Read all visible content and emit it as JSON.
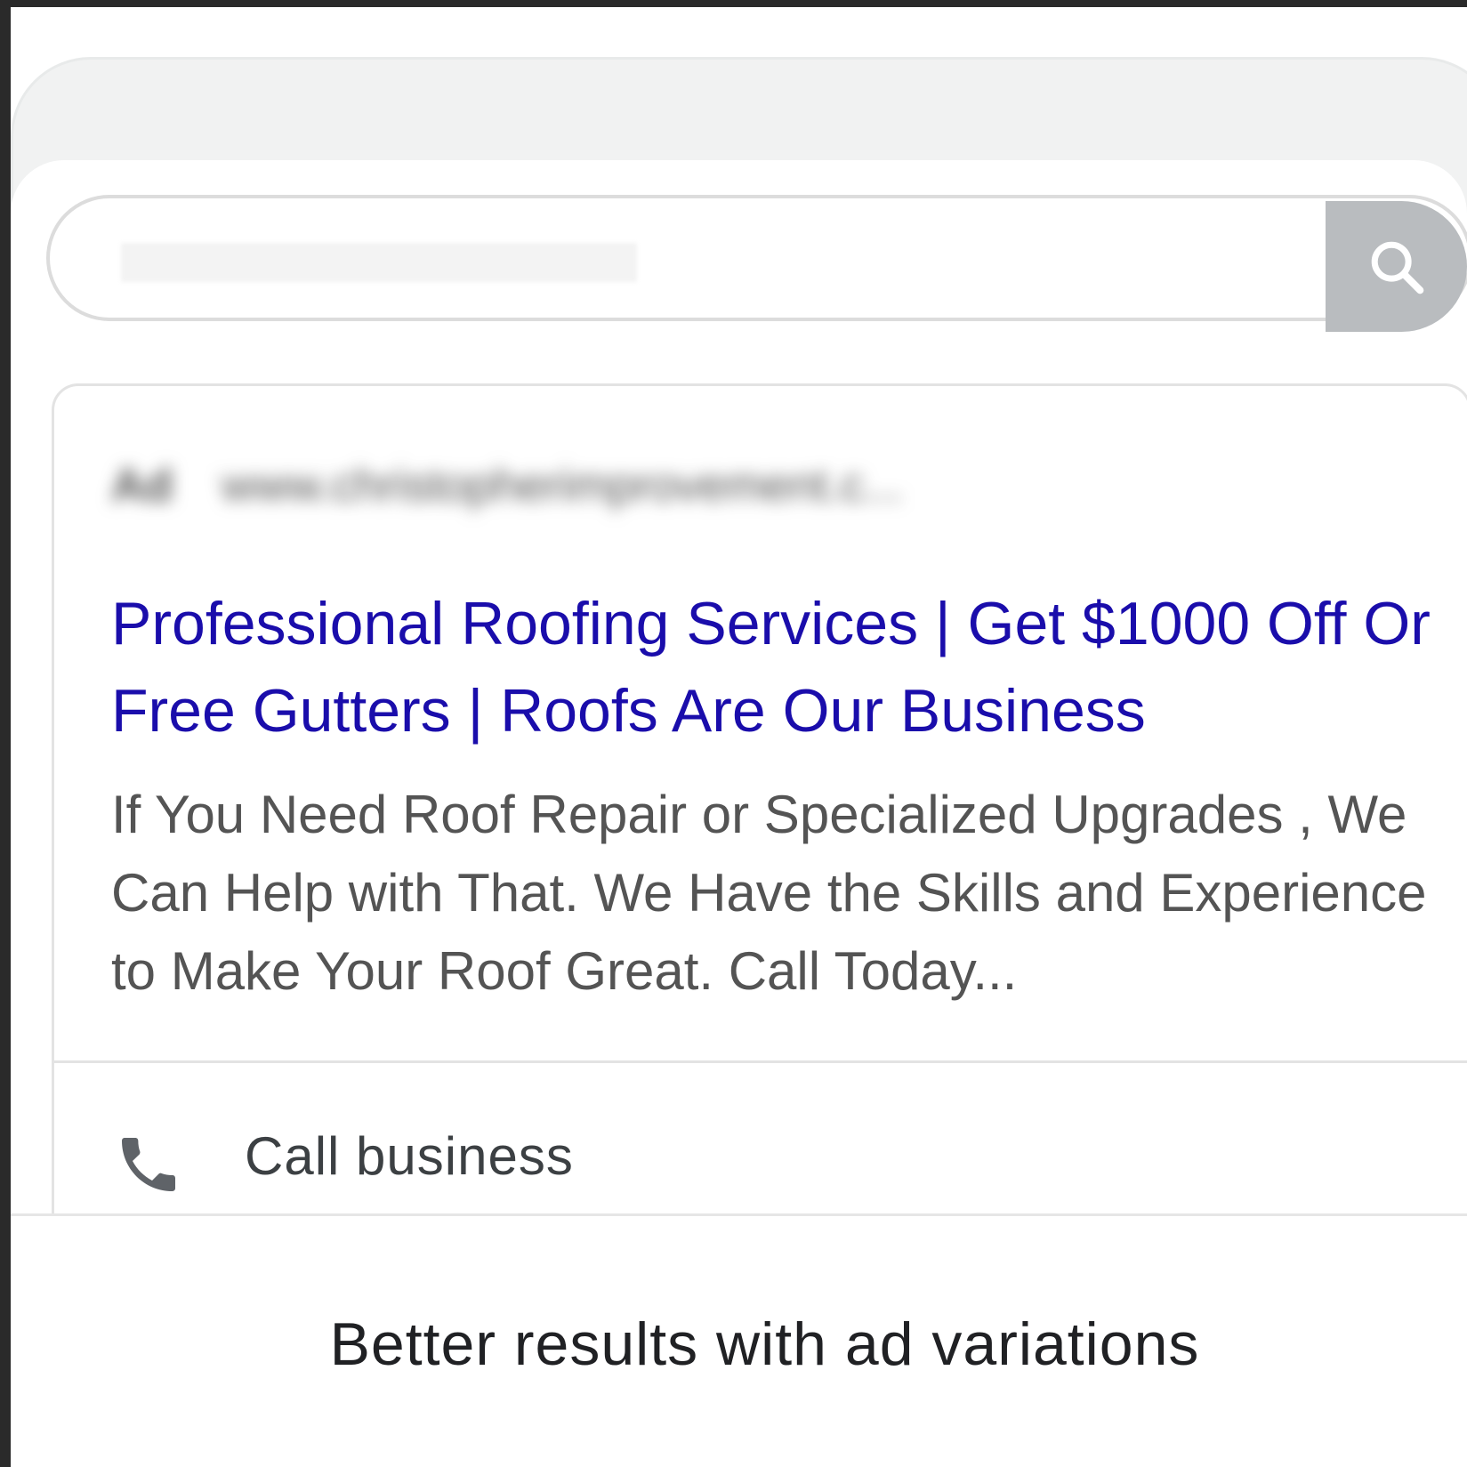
{
  "search": {
    "query": ""
  },
  "ad": {
    "tag": "Ad",
    "url": "www.christopherimprovement.c...",
    "headline": "Professional Roofing Services | Get $1000 Off Or Free Gutters | Roofs Are Our Business",
    "description": "If You Need Roof Repair or Specialized Upgrades , We Can Help with That. We Have the Skills and Experience to Make Your Roof Great. Call Today...",
    "call_label": "Call business"
  },
  "caption": "Better results with ad variations",
  "colors": {
    "headline": "#1a0dab",
    "description": "#545454",
    "search_button": "#b9bcbf"
  },
  "icons": {
    "search": "search-icon",
    "phone": "phone-icon"
  }
}
